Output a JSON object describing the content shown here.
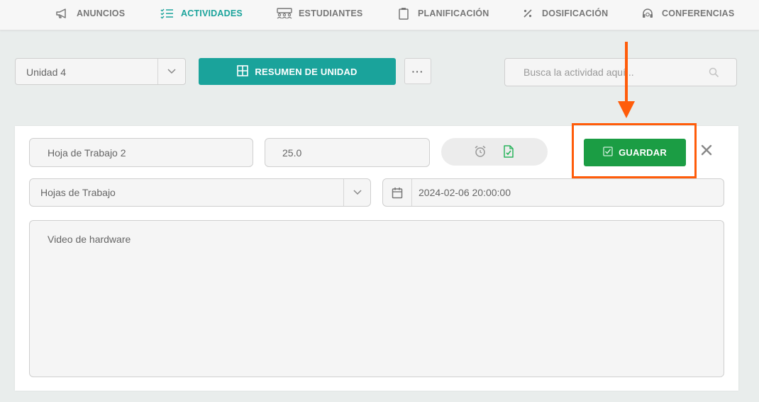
{
  "nav": {
    "items": [
      {
        "label": "ANUNCIOS",
        "icon": "megaphone-icon"
      },
      {
        "label": "ACTIVIDADES",
        "icon": "checklist-icon"
      },
      {
        "label": "ESTUDIANTES",
        "icon": "students-icon"
      },
      {
        "label": "PLANIFICACIÓN",
        "icon": "clipboard-icon"
      },
      {
        "label": "DOSIFICACIÓN",
        "icon": "percent-icon"
      },
      {
        "label": "CONFERENCIAS",
        "icon": "headset-icon"
      }
    ],
    "active": "ACTIVIDADES"
  },
  "toolbar": {
    "unit_select": "Unidad 4",
    "summary_button": "RESUMEN DE UNIDAD",
    "more_button": "···",
    "search_placeholder": "Busca la actividad aquí..."
  },
  "activity": {
    "title": "Hoja de Trabajo 2",
    "score": "25.0",
    "type": "Hojas de Trabajo",
    "due_date": "2024-02-06 20:00:00",
    "description": "Video de hardware",
    "save_button": "GUARDAR"
  },
  "colors": {
    "accent": "#1aa39b",
    "save": "#1b9d44",
    "highlight": "#ff5c0a"
  }
}
